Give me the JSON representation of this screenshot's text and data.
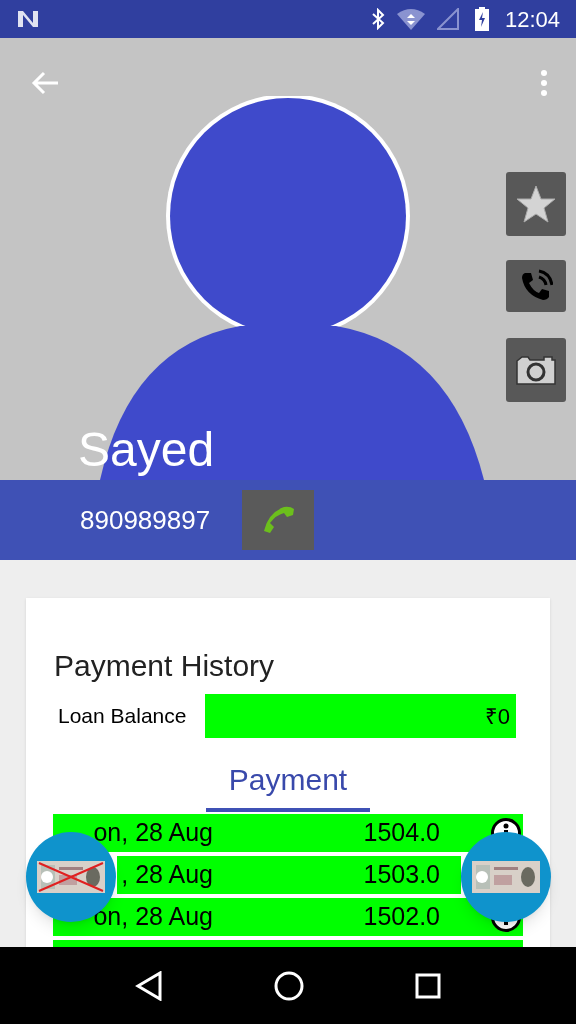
{
  "status_bar": {
    "time": "12:04"
  },
  "contact": {
    "name": "Sayed",
    "phone": "890989897"
  },
  "card": {
    "title": "Payment History",
    "loan_balance_label": "Loan Balance",
    "loan_balance": "₹0"
  },
  "tabs": [
    {
      "label": "Payment",
      "selected": true
    }
  ],
  "payments": [
    {
      "date": "on, 28 Aug",
      "amount": "1504.0",
      "icon": true
    },
    {
      "date": ", 28 Aug",
      "amount": "1503.0",
      "icon": false
    },
    {
      "date": "on, 28 Aug",
      "amount": "1502.0",
      "icon": true
    }
  ],
  "fabs": [
    {
      "kind": "no-cash"
    },
    {
      "kind": "cash"
    }
  ]
}
